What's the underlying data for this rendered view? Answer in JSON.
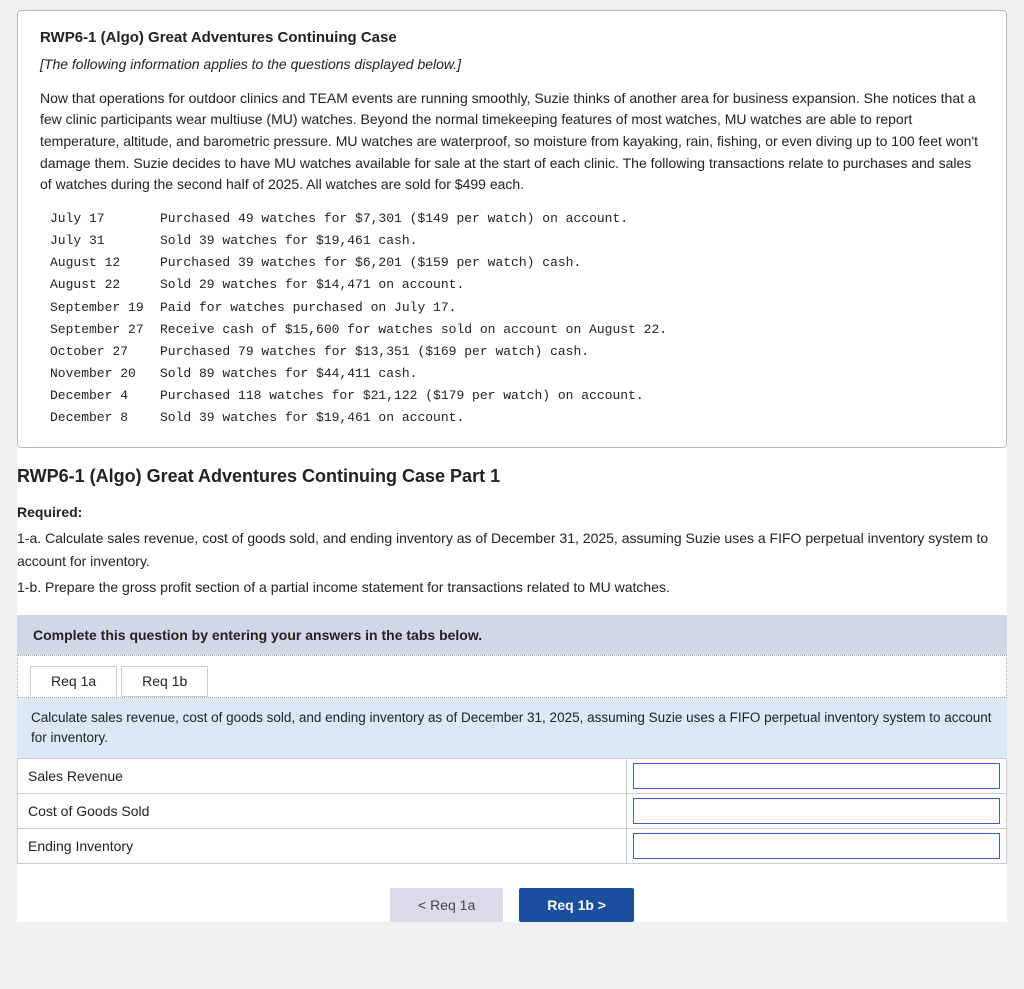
{
  "infoCard": {
    "title": "RWP6-1 (Algo) Great Adventures Continuing Case",
    "subtitle": "[The following information applies to the questions displayed below.]",
    "body": "Now that operations for outdoor clinics and TEAM events are running smoothly, Suzie thinks of another area for business expansion. She notices that a few clinic participants wear multiuse (MU) watches. Beyond the normal timekeeping features of most watches, MU watches are able to report temperature, altitude, and barometric pressure. MU watches are waterproof, so moisture from kayaking, rain, fishing, or even diving up to 100 feet won't damage them. Suzie decides to have MU watches available for sale at the start of each clinic. The following transactions relate to purchases and sales of watches during the second half of 2025. All watches are sold for $499 each.",
    "transactions": [
      {
        "date": "July 17",
        "desc": "Purchased 49 watches for $7,301 ($149 per watch) on account."
      },
      {
        "date": "July 31",
        "desc": "Sold 39 watches for $19,461 cash."
      },
      {
        "date": "August 12",
        "desc": "Purchased 39 watches for $6,201 ($159 per watch) cash."
      },
      {
        "date": "August 22",
        "desc": "Sold 29 watches for $14,471 on account."
      },
      {
        "date": "September 19",
        "desc": "Paid for watches purchased on July 17."
      },
      {
        "date": "September 27",
        "desc": "Receive cash of $15,600 for watches sold on account on August 22."
      },
      {
        "date": "October 27",
        "desc": "Purchased 79 watches for $13,351 ($169 per watch) cash."
      },
      {
        "date": "November 20",
        "desc": "Sold 89 watches for $44,411 cash."
      },
      {
        "date": "December 4",
        "desc": "Purchased 118 watches for $21,122 ($179 per watch) on account."
      },
      {
        "date": "December 8",
        "desc": "Sold 39 watches for $19,461 on account."
      }
    ]
  },
  "part1": {
    "title": "RWP6-1 (Algo) Great Adventures Continuing Case Part 1",
    "required_label": "Required:",
    "req1a": "1-a. Calculate sales revenue, cost of goods sold, and ending inventory as of December 31, 2025, assuming Suzie uses a FIFO perpetual inventory system to account for inventory.",
    "req1b": "1-b. Prepare the gross profit section of a partial income statement for transactions related to MU watches.",
    "instructionBox": "Complete this question by entering your answers in the tabs below.",
    "blueInstruction": "Calculate sales revenue, cost of goods sold, and ending inventory as of December 31, 2025, assuming Suzie uses a FIFO perpetual inventory system to account for inventory.",
    "tabs": [
      {
        "id": "req1a",
        "label": "Req 1a",
        "active": true
      },
      {
        "id": "req1b",
        "label": "Req 1b",
        "active": false
      }
    ],
    "table": {
      "rows": [
        {
          "label": "Sales Revenue",
          "value": ""
        },
        {
          "label": "Cost of Goods Sold",
          "value": ""
        },
        {
          "label": "Ending Inventory",
          "value": ""
        }
      ]
    },
    "buttons": {
      "prev_label": "< Req 1a",
      "next_label": "Req 1b >"
    }
  }
}
